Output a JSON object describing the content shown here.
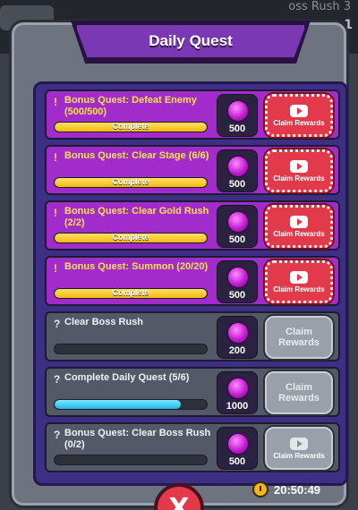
{
  "background": {
    "right_text": "oss Rush 3",
    "right_count": "1"
  },
  "title": "Daily Quest",
  "quests": [
    {
      "title": "Bonus Quest: Defeat Enemy (500/500)",
      "progress": 1.0,
      "bar_label": "Complete",
      "reward": "500",
      "claim_label": "Claim Rewards",
      "state": "active",
      "row": "purple",
      "mark": "!"
    },
    {
      "title": "Bonus Quest: Clear Stage (6/6)",
      "progress": 1.0,
      "bar_label": "Complete",
      "reward": "500",
      "claim_label": "Claim Rewards",
      "state": "active",
      "row": "purple",
      "mark": "!"
    },
    {
      "title": "Bonus Quest: Clear Gold Rush (2/2)",
      "progress": 1.0,
      "bar_label": "Complete",
      "reward": "500",
      "claim_label": "Claim Rewards",
      "state": "active",
      "row": "purple",
      "mark": "!"
    },
    {
      "title": "Bonus Quest: Summon (20/20)",
      "progress": 1.0,
      "bar_label": "Complete",
      "reward": "500",
      "claim_label": "Claim Rewards",
      "state": "active",
      "row": "purple",
      "mark": "!"
    },
    {
      "title": "Clear Boss Rush",
      "progress": 0.0,
      "bar_label": "",
      "reward": "200",
      "claim_label": "Claim Rewards",
      "state": "inactive",
      "row": "gray",
      "mark": "?"
    },
    {
      "title": "Complete Daily Quest (5/6)",
      "progress": 0.83,
      "bar_label": "",
      "reward": "1000",
      "claim_label": "Claim Rewards",
      "state": "inactive",
      "row": "gray",
      "mark": "?"
    },
    {
      "title": "Bonus Quest: Clear Boss Rush (0/2)",
      "progress": 0.0,
      "bar_label": "",
      "reward": "500",
      "claim_label": "Claim Rewards",
      "state": "inactive_video",
      "row": "gray",
      "mark": "?"
    }
  ],
  "close_label": "X",
  "timer": "20:50:49",
  "colors": {
    "accent_purple": "#a22ccb",
    "claim_red": "#e23a4a",
    "gold": "#f3b90e",
    "cyan": "#22b9e6"
  },
  "icons": {
    "reward": "gem-icon",
    "video": "play-video-icon",
    "timer": "clock-icon",
    "close": "close-icon"
  }
}
